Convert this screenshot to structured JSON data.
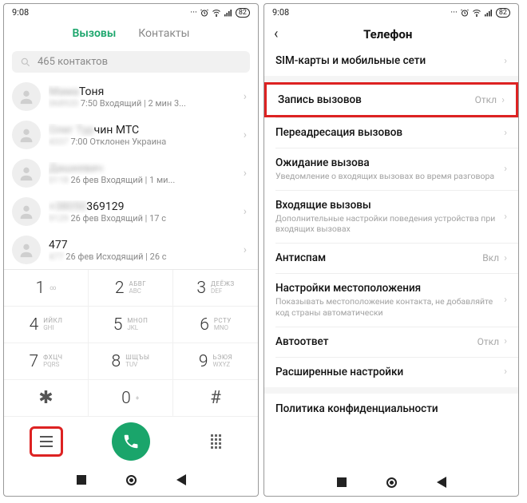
{
  "status": {
    "time": "9:08",
    "battery": "82"
  },
  "left": {
    "tabs": {
      "calls": "Вызовы",
      "contacts": "Контакты"
    },
    "search_placeholder": "465 контактов",
    "calls": [
      {
        "name_blur": "Мама",
        "name_clear": "Тоня",
        "meta_blur": "068920",
        "meta_clear": " 7:50 Входящий | 2 мин 3..."
      },
      {
        "name_blur": "Олег Тур",
        "name_clear": "чин МТС",
        "meta_blur": "4337",
        "meta_clear": " 7:00 Отклонен Украина"
      },
      {
        "name_blur": "Дашкевич",
        "name_clear": "",
        "meta_blur": "0118",
        "meta_clear": " 26 фев Входящий | 1 ми..."
      },
      {
        "name_blur": "+38050",
        "name_clear": "369129",
        "meta_blur": "9129",
        "meta_clear": " 26 фев Входящий | 17 с"
      },
      {
        "name_blur": "",
        "name_clear": "477",
        "meta_blur": "477",
        "meta_clear": " 26 фев Исходящий | 26 с"
      }
    ],
    "keypad": {
      "k1s": "∞",
      "k2": "АБВГ",
      "k2b": "ABC",
      "k3": "ДЕЁЖЗ",
      "k3b": "DEF",
      "k4": "ИЙКЛ",
      "k4b": "GHI",
      "k5": "МНОП",
      "k5b": "JKL",
      "k6": "РСТУ",
      "k6b": "MNO",
      "k7": "ФХЦЧ",
      "k7b": "PQRS",
      "k8": "ШЩЪЫ",
      "k8b": "TUV",
      "k9": "ЬЭЮЯ",
      "k9b": "WXYZ"
    }
  },
  "right": {
    "title": "Телефон",
    "rows": {
      "sim": "SIM-карты и мобильные сети",
      "rec": "Запись вызовов",
      "rec_val": "Откл",
      "fwd": "Переадресация вызовов",
      "wait": "Ожидание вызова",
      "wait_sub": "Уведомление о входящих вызовах во время разговора",
      "in": "Входящие вызовы",
      "in_sub": "Дополнительные настройки поведения устройства при входящих вызовах",
      "spam": "Антиспам",
      "spam_val": "Вкл",
      "loc": "Настройки местоположения",
      "loc_sub": "Показывать местоположение контакта, не добавляйте код страны автоматически",
      "auto": "Автоответ",
      "auto_val": "Откл",
      "ext": "Расширенные настройки",
      "priv": "Политика конфиденциальности"
    }
  }
}
